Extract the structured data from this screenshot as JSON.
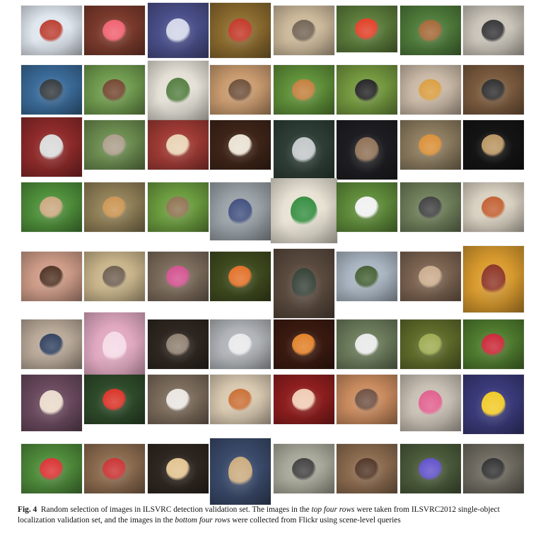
{
  "figure": {
    "label": "Fig. 4",
    "caption_parts": [
      {
        "text": "Random selection of images in ILSVRC detection validation set. The images in the ",
        "italic": false
      },
      {
        "text": "top four rows",
        "italic": true
      },
      {
        "text": " were taken from ILSVRC2012 single-object localization validation set, and the images in the ",
        "italic": false
      },
      {
        "text": "bottom four rows",
        "italic": true
      },
      {
        "text": " were collected from Flickr using scene-level queries",
        "italic": false
      }
    ]
  },
  "grid": {
    "rows": [
      [
        {
          "subject": "snowmobile",
          "bg": "#dfe6ee",
          "accent": "#b8382a"
        },
        {
          "subject": "red-light-garden",
          "bg": "#7a3a2c",
          "accent": "#f05a6a"
        },
        {
          "subject": "glass-bowl",
          "bg": "#4a4f8a",
          "accent": "#cfd3e6"
        },
        {
          "subject": "ladybug",
          "bg": "#8a6a2e",
          "accent": "#c0301e"
        },
        {
          "subject": "koala-cartoon",
          "bg": "#cbb89a",
          "accent": "#6e5f4e"
        },
        {
          "subject": "bell-peppers",
          "bg": "#5a7a3a",
          "accent": "#e0381e"
        },
        {
          "subject": "dog-on-lawn",
          "bg": "#4e7a3a",
          "accent": "#a0622e"
        },
        {
          "subject": "dog-under-table",
          "bg": "#c9c3b8",
          "accent": "#2e2e30"
        }
      ],
      [
        {
          "subject": "whale",
          "bg": "#3a6a98",
          "accent": "#2c3238"
        },
        {
          "subject": "horse-cart",
          "bg": "#6f9a4e",
          "accent": "#6e4028"
        },
        {
          "subject": "room-with-plant",
          "bg": "#e4e0d6",
          "accent": "#4f7a3a"
        },
        {
          "subject": "ox-cart",
          "bg": "#c89a6e",
          "accent": "#6a4a32"
        },
        {
          "subject": "pomeranian",
          "bg": "#5e8e38",
          "accent": "#c07a34"
        },
        {
          "subject": "black-dogs",
          "bg": "#72963e",
          "accent": "#1c1c1c"
        },
        {
          "subject": "man-with-pizza",
          "bg": "#c9b8a6",
          "accent": "#d89a3a"
        },
        {
          "subject": "skunk",
          "bg": "#7a5a3e",
          "accent": "#262626"
        }
      ],
      [
        {
          "subject": "drummers",
          "bg": "#8e2a2a",
          "accent": "#d8d8d8"
        },
        {
          "subject": "weimaraner",
          "bg": "#6a8a4e",
          "accent": "#a89a86"
        },
        {
          "subject": "crowd",
          "bg": "#9e3a34",
          "accent": "#e8d0b0"
        },
        {
          "subject": "trailer-night",
          "bg": "#3e2418",
          "accent": "#e8e0d0"
        },
        {
          "subject": "french-horn",
          "bg": "#2e3e36",
          "accent": "#c0c4c6"
        },
        {
          "subject": "dog-with-hat",
          "bg": "#1e1e22",
          "accent": "#8a6a4e"
        },
        {
          "subject": "tiger",
          "bg": "#8a7a5e",
          "accent": "#d88a2e"
        },
        {
          "subject": "lizard-night",
          "bg": "#141414",
          "accent": "#b4905a"
        }
      ],
      [
        {
          "subject": "baseball-field",
          "bg": "#4e8e3a",
          "accent": "#c8a47a"
        },
        {
          "subject": "sitting-dog",
          "bg": "#8e7e56",
          "accent": "#c8904a"
        },
        {
          "subject": "bird-on-grass",
          "bg": "#6a9a3e",
          "accent": "#8a6e4a"
        },
        {
          "subject": "child-backpack",
          "bg": "#9aa2a8",
          "accent": "#3a4a7a"
        },
        {
          "subject": "green-bottle-ruler",
          "bg": "#e8e2d4",
          "accent": "#2e8a3a"
        },
        {
          "subject": "spotted-dog",
          "bg": "#5e8a3a",
          "accent": "#f0f0f0"
        },
        {
          "subject": "man-with-dog",
          "bg": "#6e7e5a",
          "accent": "#3a3a3a"
        },
        {
          "subject": "salad-plate",
          "bg": "#d8d0c0",
          "accent": "#c05a2a"
        }
      ],
      [
        {
          "subject": "face-with-cake",
          "bg": "#cc9a86",
          "accent": "#4a2c1c"
        },
        {
          "subject": "house-shopfront",
          "bg": "#c8b48a",
          "accent": "#6a5a4a"
        },
        {
          "subject": "flower-market",
          "bg": "#7a6a5a",
          "accent": "#d04a8a"
        },
        {
          "subject": "orange-flowers",
          "bg": "#3e4a1e",
          "accent": "#e06a1e"
        },
        {
          "subject": "chalkboard",
          "bg": "#5a4a3e",
          "accent": "#2e3a30"
        },
        {
          "subject": "street-houses",
          "bg": "#a8b4c0",
          "accent": "#3e5a2e"
        },
        {
          "subject": "log-pile",
          "bg": "#7a6250",
          "accent": "#c8a888"
        },
        {
          "subject": "compass-tile",
          "bg": "#d89a2e",
          "accent": "#8a2e1e"
        }
      ],
      [
        {
          "subject": "kids-computer",
          "bg": "#b8a898",
          "accent": "#2a3a5a"
        },
        {
          "subject": "baby-blanket",
          "bg": "#e0a8c0",
          "accent": "#f4d8e4"
        },
        {
          "subject": "drum-kit",
          "bg": "#2e2620",
          "accent": "#8a7a6a"
        },
        {
          "subject": "police-car",
          "bg": "#b0b4b8",
          "accent": "#e8e8ea"
        },
        {
          "subject": "stove-night",
          "bg": "#3a1a10",
          "accent": "#e07a1e"
        },
        {
          "subject": "desk-items",
          "bg": "#6a7a5a",
          "accent": "#e8e8e8"
        },
        {
          "subject": "green-insect",
          "bg": "#5e6a2a",
          "accent": "#9aa84a"
        },
        {
          "subject": "red-flower",
          "bg": "#4e7a2e",
          "accent": "#c81e2e"
        }
      ],
      [
        {
          "subject": "lamp-lilies",
          "bg": "#6a4a5e",
          "accent": "#e8d8c8"
        },
        {
          "subject": "brunos-pizzeria",
          "bg": "#2e4a2a",
          "accent": "#d82a1e"
        },
        {
          "subject": "kitchen-woman",
          "bg": "#7a6a5a",
          "accent": "#e8e4e0"
        },
        {
          "subject": "pizza",
          "bg": "#d8c8b0",
          "accent": "#c86a2e"
        },
        {
          "subject": "red-dots",
          "bg": "#8e1e1e",
          "accent": "#f0c8b0"
        },
        {
          "subject": "desert-camel",
          "bg": "#c88a5e",
          "accent": "#6a4a3a"
        },
        {
          "subject": "kids-classroom",
          "bg": "#c8c0b4",
          "accent": "#e05a8a"
        },
        {
          "subject": "basketball",
          "bg": "#3a3a7a",
          "accent": "#f0c81e"
        }
      ],
      [
        {
          "subject": "soccer",
          "bg": "#4e8a3a",
          "accent": "#d82a2a"
        },
        {
          "subject": "shop-interior",
          "bg": "#8a6a4e",
          "accent": "#c82a2a"
        },
        {
          "subject": "bar-tv",
          "bg": "#2e2620",
          "accent": "#e0c08a"
        },
        {
          "subject": "rodeo",
          "bg": "#3a4a6a",
          "accent": "#c8a87a"
        },
        {
          "subject": "meeting-room",
          "bg": "#a8a89a",
          "accent": "#3a3a3a"
        },
        {
          "subject": "dining-table",
          "bg": "#8a6a4e",
          "accent": "#4a2e1e"
        },
        {
          "subject": "blue-flower",
          "bg": "#4a5a3a",
          "accent": "#5a4ac8"
        },
        {
          "subject": "kitchen-dark",
          "bg": "#6e6a60",
          "accent": "#2a2a2a"
        }
      ]
    ]
  }
}
